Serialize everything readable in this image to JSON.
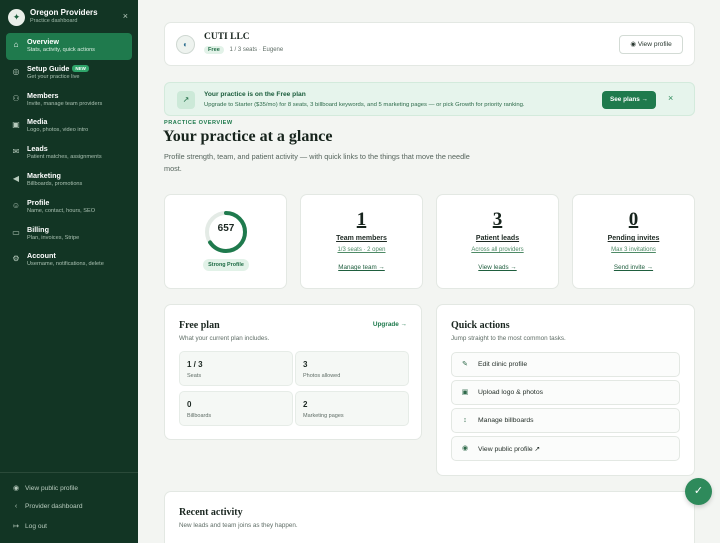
{
  "brand": {
    "name": "Oregon Providers",
    "subtitle": "Practice dashboard",
    "logo_icon": "leaf-icon",
    "close_glyph": "×"
  },
  "sidebar": {
    "items": [
      {
        "label": "Overview",
        "sub": "Stats, activity, quick actions",
        "icon": "grid-icon",
        "glyph": "⌂",
        "active": true
      },
      {
        "label": "Setup Guide",
        "badge": "NEW",
        "sub": "Get your practice live",
        "icon": "compass-icon",
        "glyph": "◎"
      },
      {
        "label": "Members",
        "sub": "Invite, manage team providers",
        "icon": "users-icon",
        "glyph": "⚇"
      },
      {
        "label": "Media",
        "sub": "Logo, photos, video intro",
        "icon": "image-icon",
        "glyph": "▣"
      },
      {
        "label": "Leads",
        "sub": "Patient matches, assignments",
        "icon": "mail-icon",
        "glyph": "✉"
      },
      {
        "label": "Marketing",
        "sub": "Billboards, promotions",
        "icon": "megaphone-icon",
        "glyph": "◀"
      },
      {
        "label": "Profile",
        "sub": "Name, contact, hours, SEO",
        "icon": "user-icon",
        "glyph": "☺"
      },
      {
        "label": "Billing",
        "sub": "Plan, invoices, Stripe",
        "icon": "card-icon",
        "glyph": "▭"
      },
      {
        "label": "Account",
        "sub": "Username, notifications, delete",
        "icon": "gear-icon",
        "glyph": "⚙"
      }
    ],
    "footer": [
      {
        "label": "View public profile",
        "icon": "eye-icon",
        "glyph": "◉"
      },
      {
        "label": "Provider dashboard",
        "icon": "chevron-left-icon",
        "glyph": "‹"
      },
      {
        "label": "Log out",
        "icon": "logout-icon",
        "glyph": "↦"
      }
    ]
  },
  "org": {
    "name": "CUTI LLC",
    "plan": "Free",
    "seats": "1 / 3 seats",
    "sep": "·",
    "city": "Eugene",
    "avatar_icon": "clinic-logo-icon",
    "view_profile": "View profile"
  },
  "banner": {
    "title": "Your practice is on the Free plan",
    "text": "Upgrade to Starter ($35/mo) for 8 seats, 3 billboard keywords, and 5 marketing pages — or pick Growth for priority ranking.",
    "cta": "See plans →",
    "close": "×"
  },
  "overview": {
    "eyebrow": "PRACTICE OVERVIEW",
    "title": "Your practice at a glance",
    "desc": "Profile strength, team, and patient activity — with quick links to the things that move the needle most."
  },
  "score": {
    "value": "657",
    "fraction": 0.657,
    "label": "Strong Profile",
    "color": "#1f7a4d"
  },
  "stats": [
    {
      "num": "1",
      "label": "Team members",
      "sub": "1/3 seats · 2 open",
      "link": "Manage team →"
    },
    {
      "num": "3",
      "label": "Patient leads",
      "sub": "Across all providers",
      "link": "View leads →"
    },
    {
      "num": "0",
      "label": "Pending invites",
      "sub": "Max 3 invitations",
      "link": "Send invite →"
    }
  ],
  "plan": {
    "title": "Free plan",
    "sub": "What your current plan includes.",
    "upgrade": "Upgrade →",
    "tiles": [
      {
        "value": "1 / 3",
        "label": "Seats"
      },
      {
        "value": "3",
        "label": "Photos allowed"
      },
      {
        "value": "0",
        "label": "Billboards"
      },
      {
        "value": "2",
        "label": "Marketing pages"
      }
    ]
  },
  "quick": {
    "title": "Quick actions",
    "sub": "Jump straight to the most common tasks.",
    "items": [
      {
        "label": "Edit clinic profile",
        "icon": "edit-icon",
        "glyph": "✎"
      },
      {
        "label": "Upload logo & photos",
        "icon": "upload-image-icon",
        "glyph": "▣"
      },
      {
        "label": "Manage billboards",
        "icon": "billboard-icon",
        "glyph": "↕"
      },
      {
        "label": "View public profile ↗",
        "icon": "eye-icon",
        "glyph": "◉"
      }
    ]
  },
  "recent": {
    "title": "Recent activity",
    "sub": "New leads and team joins as they happen."
  },
  "fab": {
    "glyph": "✓",
    "icon": "check-icon"
  }
}
